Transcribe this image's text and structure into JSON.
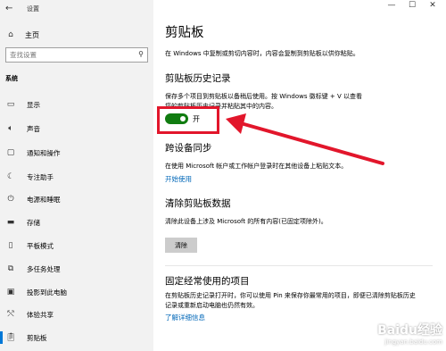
{
  "window": {
    "title": "设置",
    "back_icon": "back-arrow-icon"
  },
  "sidebar": {
    "home": {
      "label": "主页",
      "icon": "home-icon"
    },
    "search": {
      "placeholder": "查找设置",
      "icon": "search-icon"
    },
    "section": "系统",
    "items": [
      {
        "label": "显示",
        "icon": "display-icon"
      },
      {
        "label": "声音",
        "icon": "sound-icon"
      },
      {
        "label": "通知和操作",
        "icon": "notification-icon"
      },
      {
        "label": "专注助手",
        "icon": "focus-assist-icon"
      },
      {
        "label": "电源和睡眠",
        "icon": "power-icon"
      },
      {
        "label": "存储",
        "icon": "storage-icon"
      },
      {
        "label": "平板模式",
        "icon": "tablet-mode-icon"
      },
      {
        "label": "多任务处理",
        "icon": "multitasking-icon"
      },
      {
        "label": "投影到此电脑",
        "icon": "projecting-icon"
      },
      {
        "label": "体验共享",
        "icon": "shared-experiences-icon"
      },
      {
        "label": "剪贴板",
        "icon": "clipboard-icon"
      }
    ]
  },
  "main": {
    "title": "剪贴板",
    "intro": "在 Windows 中复制或剪切内容时，内容会复制到剪贴板以供你粘贴。",
    "history": {
      "heading": "剪贴板历史记录",
      "desc_line1": "保存多个项目到剪贴板以备稍后使用。按 Windows 徽标键 + V 以查看",
      "desc_line2": "您的剪贴板历史记录并粘贴其中的内容。",
      "toggle_label": "开",
      "toggle_on": true
    },
    "sync": {
      "heading": "跨设备同步",
      "desc": "在使用 Microsoft 帐户或工作帐户登录时在其他设备上粘贴文本。",
      "link": "开始使用"
    },
    "clear": {
      "heading": "清除剪贴板数据",
      "desc": "清除此设备上涉及 Microsoft 的所有内容(已固定项除外)。",
      "button": "清除"
    },
    "pinned": {
      "heading": "固定经常使用的项目",
      "desc_line1": "在剪贴板历史记录打开时，你可以使用 Pin 来保存你最常用的项目，即便已清除剪贴板历史",
      "desc_line2": "记录或重新启动电脑也仍然有效。",
      "link": "了解详细信息"
    }
  },
  "window_controls": {
    "minimize": "—",
    "maximize": "☐",
    "close": "✕"
  },
  "watermark": {
    "text": "Baidu经验",
    "sub": "jingyan.baidu.com"
  },
  "colors": {
    "accent": "#0078d7",
    "toggle_on": "#107c10",
    "highlight": "#e2162b",
    "link": "#0067b8"
  }
}
